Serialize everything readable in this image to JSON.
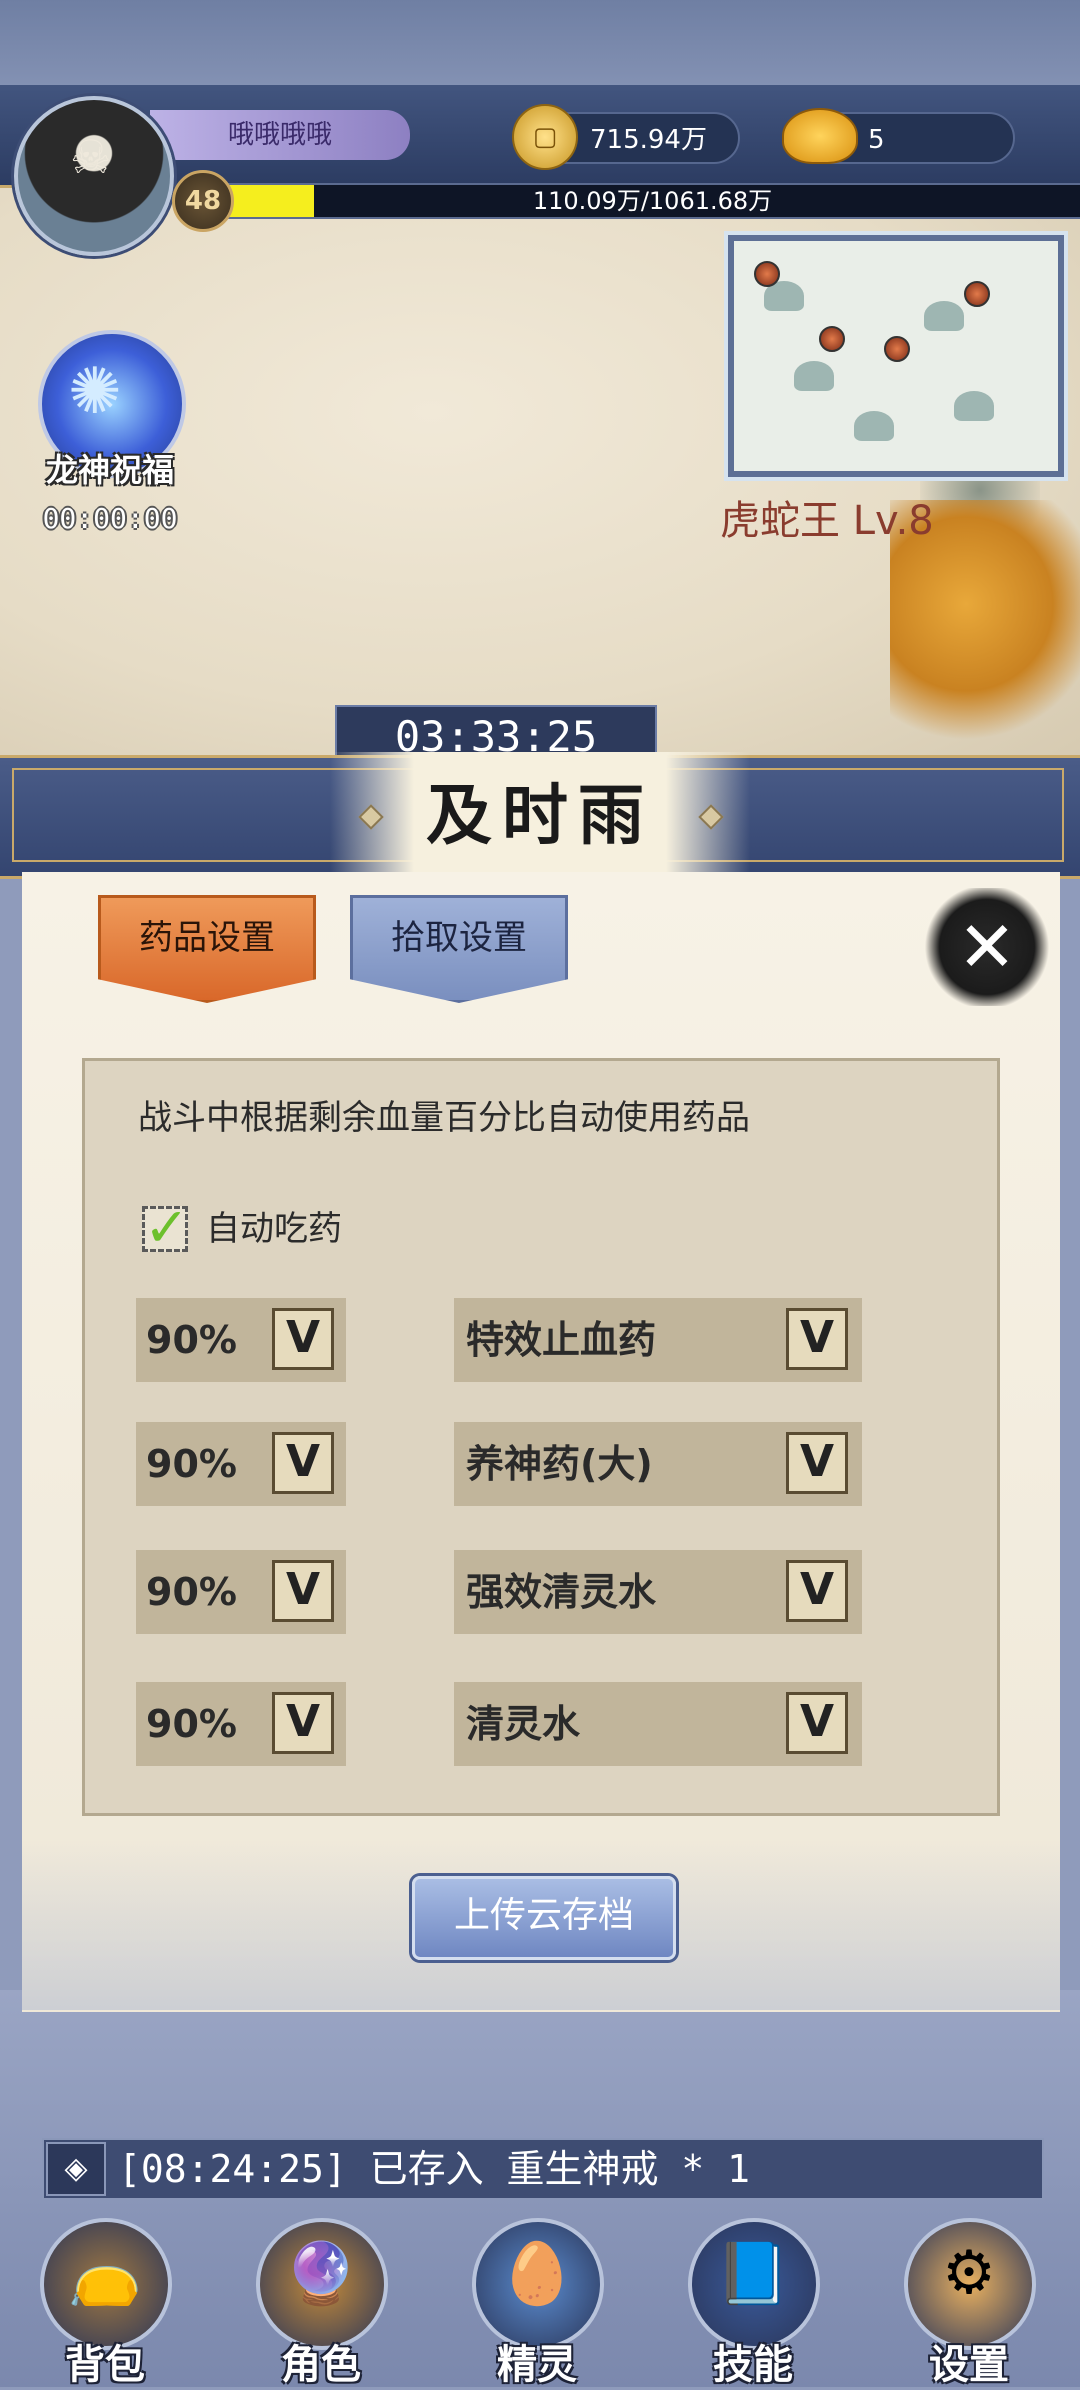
{
  "player": {
    "name": "哦哦哦哦",
    "level": "48",
    "exp_text": "110.09万/1061.68万",
    "exp_fraction": 0.104
  },
  "currency": {
    "coins": "715.94万",
    "gold": "5"
  },
  "buff": {
    "name": "龙神祝福",
    "timer": "00:00:00"
  },
  "minimap": {
    "boss_label": "虎蛇王 Lv.8"
  },
  "stage_timer": "03:33:25",
  "dialog": {
    "title": "及时雨",
    "tabs": [
      {
        "label": "药品设置",
        "active": true
      },
      {
        "label": "拾取设置",
        "active": false
      }
    ],
    "description": "战斗中根据剩余血量百分比自动使用药品",
    "auto_potion": {
      "label": "自动吃药",
      "checked": true
    },
    "rows": [
      {
        "percent": "90%",
        "potion": "特效止血药"
      },
      {
        "percent": "90%",
        "potion": "养神药(大)"
      },
      {
        "percent": "90%",
        "potion": "强效清灵水"
      },
      {
        "percent": "90%",
        "potion": "清灵水"
      }
    ],
    "dropdown_glyph": "V",
    "upload_label": "上传云存档"
  },
  "log": {
    "text": "[08:24:25] 已存入 重生神戒 * 1"
  },
  "nav": [
    {
      "label": "背包",
      "icon": "bag-icon",
      "glyph": "👝",
      "color": "#a07842"
    },
    {
      "label": "角色",
      "icon": "character-icon",
      "glyph": "🔮",
      "color": "#c38a3a"
    },
    {
      "label": "精灵",
      "icon": "spirit-egg-icon",
      "glyph": "🥚",
      "color": "#5b8ccf"
    },
    {
      "label": "技能",
      "icon": "skill-book-icon",
      "glyph": "📘",
      "color": "#3a5a9a"
    },
    {
      "label": "设置",
      "icon": "settings-icon",
      "glyph": "⚙",
      "color": "#e8b060"
    }
  ]
}
